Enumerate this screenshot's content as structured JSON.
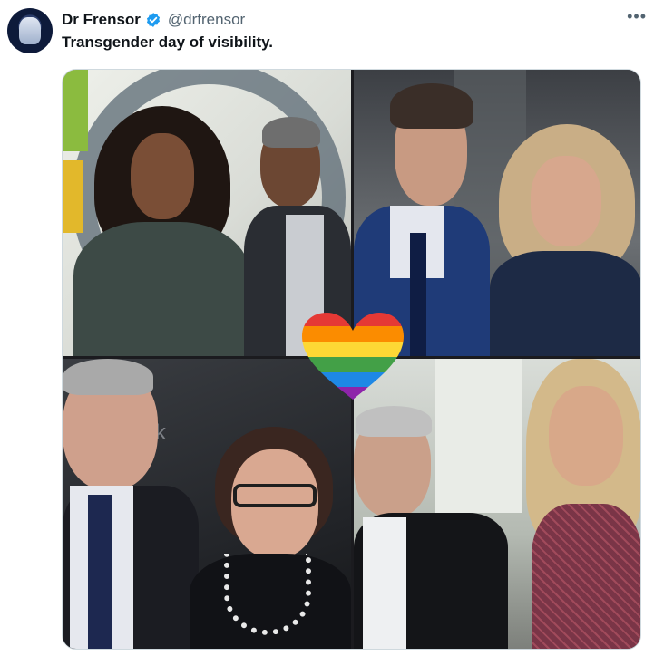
{
  "tweet": {
    "author_name": "Dr Frensor",
    "author_handle": "@drfrensor",
    "text": "Transgender day of visibility.",
    "more_icon": "more-options-icon",
    "verified_icon": "verified-badge-icon"
  },
  "media": {
    "overlay_icon": "rainbow-heart-icon",
    "watermark_q3": "rk",
    "colors": {
      "verified": "#1d9bf0",
      "rainbow": [
        "#e53935",
        "#fb8c00",
        "#fdd835",
        "#43a047",
        "#1e88e5",
        "#8e24aa"
      ]
    }
  }
}
